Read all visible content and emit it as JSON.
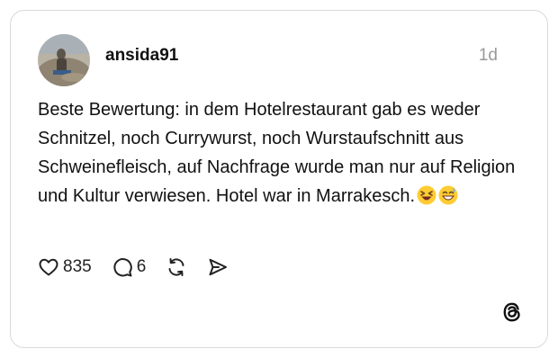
{
  "post": {
    "username": "ansida91",
    "timestamp": "1d",
    "text": "Beste Bewertung: in dem Hotelrestaurant gab es weder Schnitzel, noch Currywurst, noch Wurstaufschnitt aus Schweinefleisch, auf Nachfrage wurde man nur auf Religion und Kultur verwiesen. Hotel war in Marrakesch.",
    "emojis": [
      "laughing-face-emoji",
      "grinning-sweat-emoji"
    ]
  },
  "actions": {
    "like_count": "835",
    "reply_count": "6",
    "icons": [
      "heart-icon",
      "reply-bubble-icon",
      "repost-icon",
      "share-icon"
    ]
  },
  "footer": {
    "logo": "threads-logo-icon"
  },
  "colors": {
    "text": "#111111",
    "muted": "#999999",
    "border": "#d9d9d9"
  }
}
